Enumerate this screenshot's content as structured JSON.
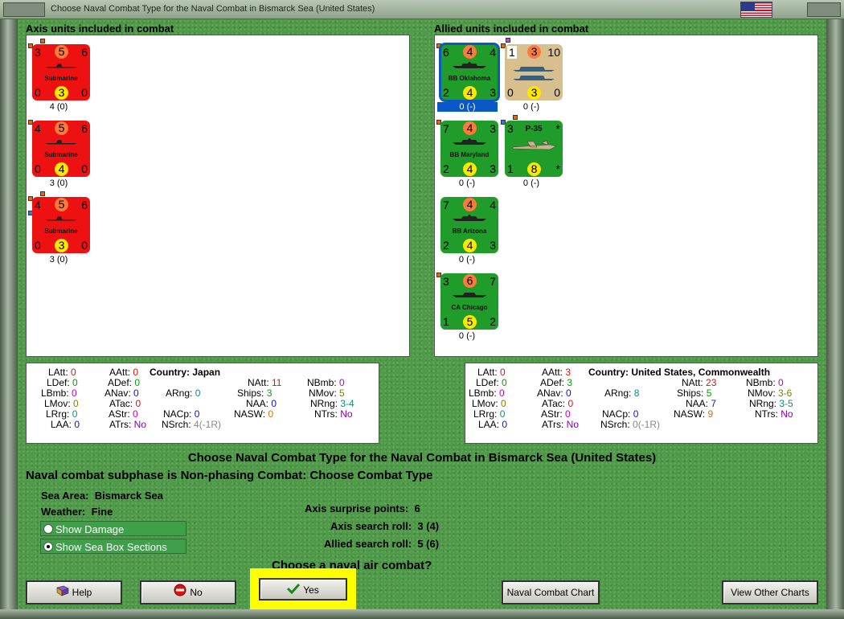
{
  "window": {
    "title": "Choose Naval Combat Type for the Naval Combat in Bismarck Sea (United States)"
  },
  "axis": {
    "heading": "Axis units included in combat",
    "units": [
      {
        "tl": "3",
        "cto": "5",
        "tr": "6",
        "name": "Submarine",
        "bl": "0",
        "cby": "3",
        "br": "0",
        "below": "4 (0)"
      },
      {
        "tl": "4",
        "cto": "5",
        "tr": "6",
        "name": "Submarine",
        "bl": "0",
        "cby": "4",
        "br": "0",
        "below": "3 (0)"
      },
      {
        "tl": "4",
        "cto": "5",
        "tr": "6",
        "name": "Submarine",
        "bl": "0",
        "cby": "3",
        "br": "0",
        "below": "3 (0)"
      }
    ]
  },
  "allied": {
    "heading": "Allied units included in combat",
    "units": [
      {
        "tl": "6",
        "cto": "4",
        "tr": "4",
        "name": "BB Oklahoma",
        "bl": "2",
        "cby": "4",
        "br": "3",
        "below": "0 (-)"
      },
      {
        "tl": "1",
        "cto": "3",
        "tr": "10",
        "name": "",
        "bl": "0",
        "cby": "3",
        "br": "0",
        "below": "0 (-)"
      },
      {
        "tl": "7",
        "cto": "4",
        "tr": "3",
        "name": "BB Maryland",
        "bl": "2",
        "cby": "4",
        "br": "3",
        "below": "0 (-)"
      },
      {
        "tl": "3",
        "cto": "",
        "tr": "*",
        "name": "P-35",
        "bl": "1",
        "cby": "8",
        "br": "*",
        "below": "0 (-)"
      },
      {
        "tl": "7",
        "cto": "4",
        "tr": "4",
        "name": "BB Arizona",
        "bl": "2",
        "cby": "4",
        "br": "3",
        "below": "0 (-)"
      },
      {
        "tl": "3",
        "cto": "6",
        "tr": "7",
        "name": "CA Chicago",
        "bl": "1",
        "cby": "5",
        "br": "2",
        "below": "0 (-)"
      }
    ]
  },
  "axis_stats": {
    "LAtt": "0",
    "LDef": "0",
    "LBmb": "0",
    "LMov": "0",
    "LRrg": "0",
    "LAA": "0",
    "AAtt": "0",
    "ADef": "0",
    "ANav": "0",
    "ATac": "0",
    "AStr": "0",
    "ATrs": "No",
    "country_label": "Country:",
    "country": "Japan",
    "ARng": "0",
    "NACp": "0",
    "NSrch": "4(-1R)",
    "NAtt": "11",
    "Ships": "3",
    "NAA": "0",
    "NASW": "0",
    "NBmb": "0",
    "NMov": "5",
    "NRng": "3-4",
    "NTrs": "No"
  },
  "allied_stats": {
    "LAtt": "0",
    "LDef": "0",
    "LBmb": "0",
    "LMov": "0",
    "LRrg": "0",
    "LAA": "0",
    "AAtt": "3",
    "ADef": "3",
    "ANav": "0",
    "ATac": "0",
    "AStr": "0",
    "ATrs": "No",
    "country_label": "Country:",
    "country": "United States, Commonwealth",
    "ARng": "8",
    "NACp": "0",
    "NSrch": "0(-1R)",
    "NAtt": "23",
    "Ships": "5",
    "NAA": "7",
    "NASW": "9",
    "NBmb": "0",
    "NMov": "3-6",
    "NRng": "3-5",
    "NTrs": "No"
  },
  "main": {
    "title": "Choose Naval Combat Type for the Naval Combat in Bismarck Sea (United States)",
    "subtitle": "Naval combat subphase is Non-phasing Combat: Choose Combat Type",
    "sea_area_label": "Sea Area:",
    "sea_area": "Bismarck Sea",
    "weather_label": "Weather:",
    "weather": "Fine",
    "show_damage": "Show Damage",
    "show_sea_box": "Show Sea Box Sections",
    "axis_surprise_label": "Axis surprise points:",
    "axis_surprise": "6",
    "axis_search_label": "Axis search roll:",
    "axis_search": "3 (4)",
    "allied_search_label": "Allied search roll:",
    "allied_search": "5 (6)",
    "question": "Choose a naval air combat?"
  },
  "buttons": {
    "help": "Help",
    "no": "No",
    "yes": "Yes",
    "naval_chart": "Naval Combat Chart",
    "other_charts": "View Other Charts"
  },
  "colors": {
    "axis_unit": "#ee1111",
    "allied_unit": "#1f9c2a",
    "selection": "#0a58c6",
    "highlight": "#ffff00"
  }
}
